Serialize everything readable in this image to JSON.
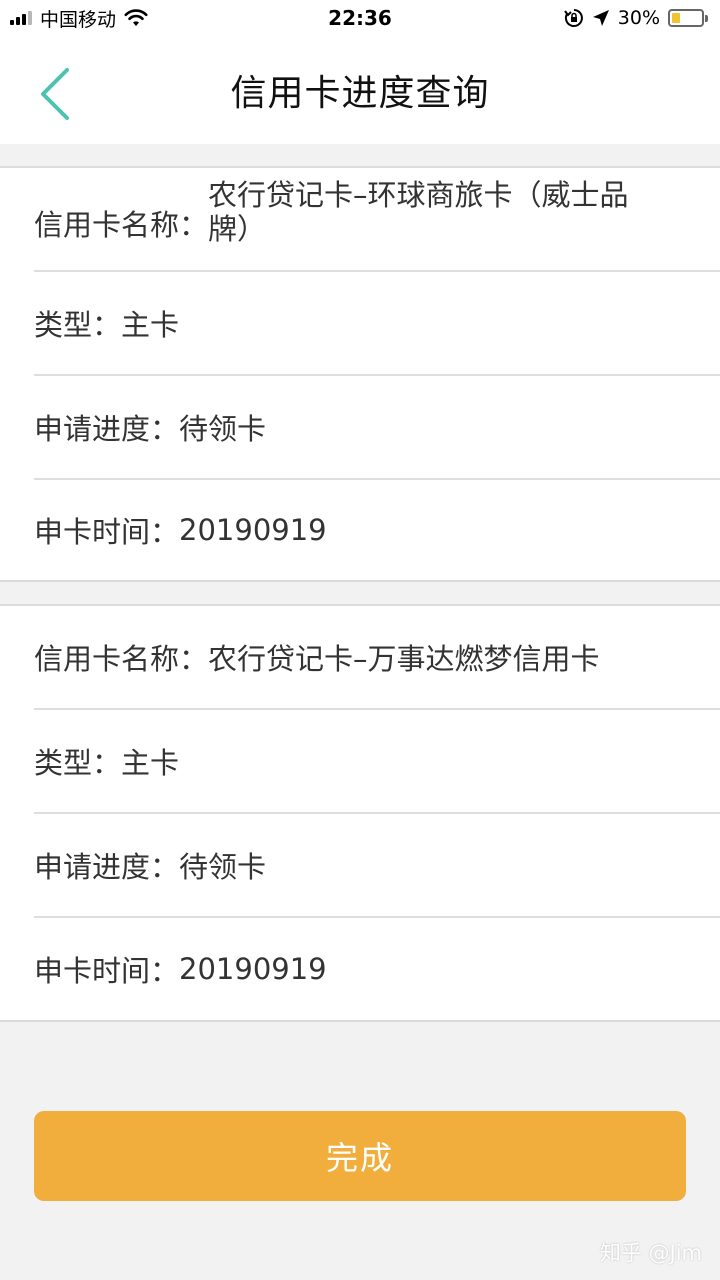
{
  "status_bar": {
    "carrier": "中国移动",
    "time": "22:36",
    "battery_percent": "30%",
    "battery_level": 0.3,
    "icons": [
      "signal-icon",
      "wifi-icon",
      "orientation-lock-icon",
      "location-icon",
      "battery-icon"
    ]
  },
  "nav": {
    "title": "信用卡进度查询",
    "back_icon": "chevron-left-icon",
    "back_color": "#4cc2b0"
  },
  "cards": [
    {
      "rows": [
        {
          "label": "信用卡名称：",
          "value": "农行贷记卡–环球商旅卡（威士品牌）"
        },
        {
          "label": "类型：",
          "value": "主卡"
        },
        {
          "label": "申请进度：",
          "value": "待领卡"
        },
        {
          "label": "申卡时间：",
          "value": "20190919"
        }
      ]
    },
    {
      "rows": [
        {
          "label": "信用卡名称：",
          "value": "农行贷记卡–万事达燃梦信用卡"
        },
        {
          "label": "类型：",
          "value": "主卡"
        },
        {
          "label": "申请进度：",
          "value": "待领卡"
        },
        {
          "label": "申卡时间：",
          "value": "20190919"
        }
      ]
    }
  ],
  "done_button": {
    "label": "完成",
    "color": "#f2ae3c"
  },
  "watermark": "知乎 @Jim"
}
